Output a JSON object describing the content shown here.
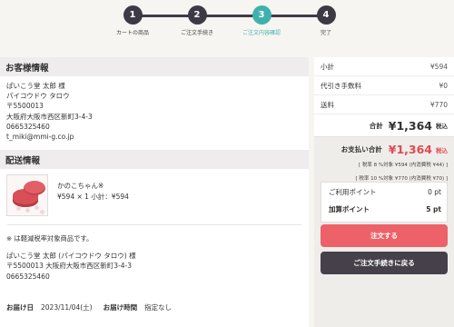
{
  "steps": [
    {
      "num": "1",
      "label": "カートの商品",
      "active": false
    },
    {
      "num": "2",
      "label": "ご注文手続き",
      "active": false
    },
    {
      "num": "3",
      "label": "ご注文内容確認",
      "active": true
    },
    {
      "num": "4",
      "label": "完了",
      "active": false
    }
  ],
  "customer": {
    "heading": "お客様情報",
    "name": "ぱいこう堂 太郎 様",
    "kana": "パイコウドウ タロウ",
    "postal": "〒5500013",
    "address": "大阪府大阪市西区新町3-4-3",
    "phone": "0665325460",
    "email": "t_miki@mmi-g.co.jp"
  },
  "delivery": {
    "heading": "配送情報",
    "product_name": "かのこちゃん※",
    "product_price_line": "¥594 × 1  小計：¥594",
    "note": "※ は軽減税率対象商品です。",
    "recipient": "ぱいこう堂 太郎 (パイコウドウ タロウ) 様",
    "recipient_address": "〒5500013 大阪府大阪市西区新町3-4-3",
    "recipient_phone": "0665325460",
    "date_label": "お届け日",
    "date_value": "2023/11/04(土)",
    "time_label": "お届け時間",
    "time_value": "指定なし"
  },
  "summary": {
    "subtotal_label": "小計",
    "subtotal_value": "¥594",
    "fee_label": "代引き手数料",
    "fee_value": "¥0",
    "shipping_label": "送料",
    "shipping_value": "¥770",
    "total_label": "合計",
    "total_value": "¥1,364",
    "total_tax": "税込",
    "pay_label": "お支払い合計",
    "pay_value": "¥1,364",
    "pay_tax": "税込",
    "tax8_line": "[ 税率 8 %対象 ¥594 (内消費税 ¥44) ]",
    "tax10_line": "[ 税率 10 %対象 ¥770 (内消費税 ¥70) ]"
  },
  "points": {
    "use_label": "ご利用ポイント",
    "use_value": "0 pt",
    "add_label": "加算ポイント",
    "add_value": "5 pt"
  },
  "buttons": {
    "order": "注文する",
    "back": "ご注文手続きに戻る"
  },
  "colors": {
    "accent_teal": "#3fb1ad",
    "order_red": "#ec6268",
    "price_red": "#e04a52",
    "dark": "#45404a"
  }
}
